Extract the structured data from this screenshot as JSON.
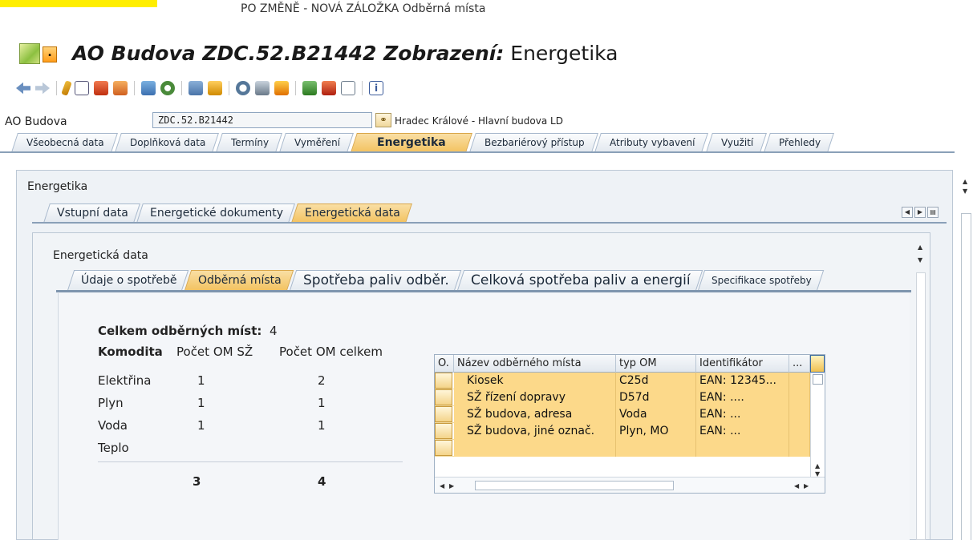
{
  "caption": "PO ZMĚNĚ - NOVÁ ZÁLOŽKA Odběrná místa",
  "window": {
    "title_italic": "AO Budova ZDC.52.B21442 Zobrazení:",
    "title_plain": " Energetika"
  },
  "header": {
    "field_label": "AO Budova",
    "field_value": "ZDC.52.B21442",
    "field_description": "Hradec Králové - Hlavní budova LD"
  },
  "main_tabs": [
    {
      "label": "Všeobecná data"
    },
    {
      "label": "Doplňková data"
    },
    {
      "label": "Termíny"
    },
    {
      "label": "Vyměření"
    },
    {
      "label": "Energetika"
    },
    {
      "label": "Bezbariérový přístup"
    },
    {
      "label": "Atributy vybavení"
    },
    {
      "label": "Využití"
    },
    {
      "label": "Přehledy"
    }
  ],
  "energetika": {
    "title": "Energetika",
    "tabs": [
      {
        "label": "Vstupní data"
      },
      {
        "label": "Energetické dokumenty"
      },
      {
        "label": "Energetická data"
      }
    ]
  },
  "energeticka_data": {
    "title": "Energetická data",
    "tabs": [
      {
        "label": "Údaje o spotřebě"
      },
      {
        "label": "Odběrná místa"
      },
      {
        "label": "Spotřeba paliv odběr."
      },
      {
        "label": "Celková spotřeba paliv a energií"
      },
      {
        "label": "Specifikace spotřeby"
      }
    ]
  },
  "summary": {
    "total_label": "Celkem odběrných míst:",
    "total_value": "4",
    "headers": [
      "Komodita",
      "Počet OM SŽ",
      "Počet OM celkem"
    ],
    "rows": [
      {
        "commodity": "Elektřina",
        "sz": "1",
        "total": "2"
      },
      {
        "commodity": "Plyn",
        "sz": "1",
        "total": "1"
      },
      {
        "commodity": "Voda",
        "sz": "1",
        "total": "1"
      },
      {
        "commodity": "Teplo",
        "sz": "",
        "total": ""
      }
    ],
    "sum_sz": "3",
    "sum_total": "4"
  },
  "grid": {
    "headers": [
      "O.",
      "Název odběrného místa",
      "typ OM",
      "Identifikátor",
      "..."
    ],
    "rows": [
      {
        "name": "Kiosek",
        "type": "C25d",
        "id": "EAN: 12345..."
      },
      {
        "name": "SŽ řízení dopravy",
        "type": "D57d",
        "id": "EAN: ...."
      },
      {
        "name": "SŽ budova, adresa",
        "type": "Voda",
        "id": "EAN: ..."
      },
      {
        "name": "SŽ budova, jiné označ.",
        "type": " Plyn, MO",
        "id": "EAN: ..."
      },
      {
        "name": "",
        "type": "",
        "id": ""
      }
    ]
  },
  "colors": {
    "active_tab": "#f3c25f",
    "selected_row": "#fcd98a",
    "highlight": "#ffee00"
  }
}
